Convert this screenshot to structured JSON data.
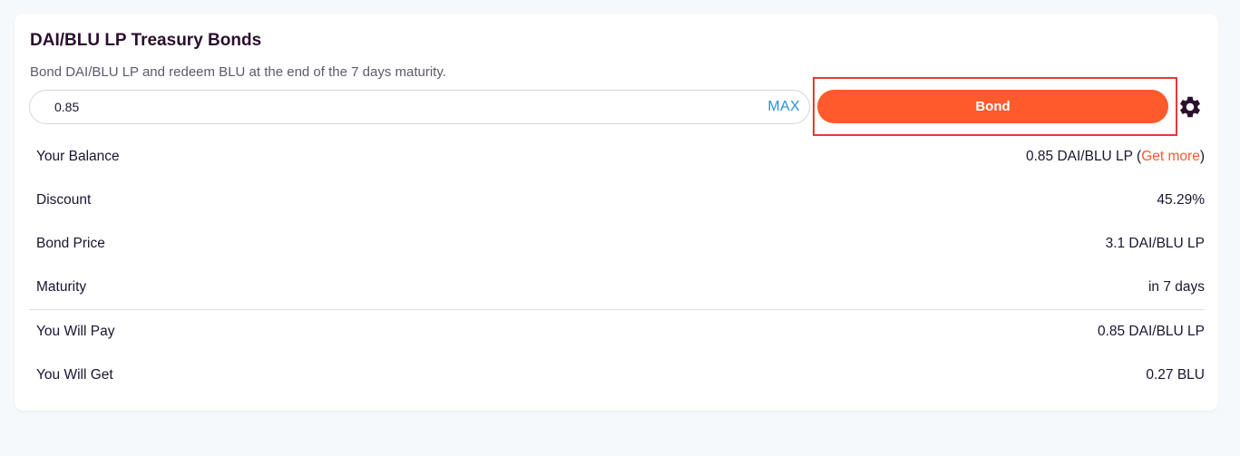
{
  "header": {
    "title": "DAI/BLU LP Treasury Bonds",
    "subtitle": "Bond DAI/BLU LP and redeem BLU at the end of the 7 days maturity."
  },
  "form": {
    "amount_value": "0.85",
    "max_label": "MAX",
    "bond_label": "Bond",
    "settings_icon": "gear-icon"
  },
  "details": {
    "balance_label": "Your Balance",
    "balance_value": "0.85 DAI/BLU LP",
    "balance_open": " (",
    "get_more_label": "Get more",
    "balance_close": ")",
    "discount_label": "Discount",
    "discount_value": "45.29%",
    "price_label": "Bond Price",
    "price_value": "3.1 DAI/BLU LP",
    "maturity_label": "Maturity",
    "maturity_value": "in 7 days",
    "pay_label": "You Will Pay",
    "pay_value": "0.85 DAI/BLU LP",
    "get_label": "You Will Get",
    "get_value": "0.27 BLU"
  },
  "colors": {
    "accent": "#ff5a2c",
    "link_blue": "#2b8fd6",
    "highlight_border": "#e53935",
    "title": "#2b0f2f"
  }
}
